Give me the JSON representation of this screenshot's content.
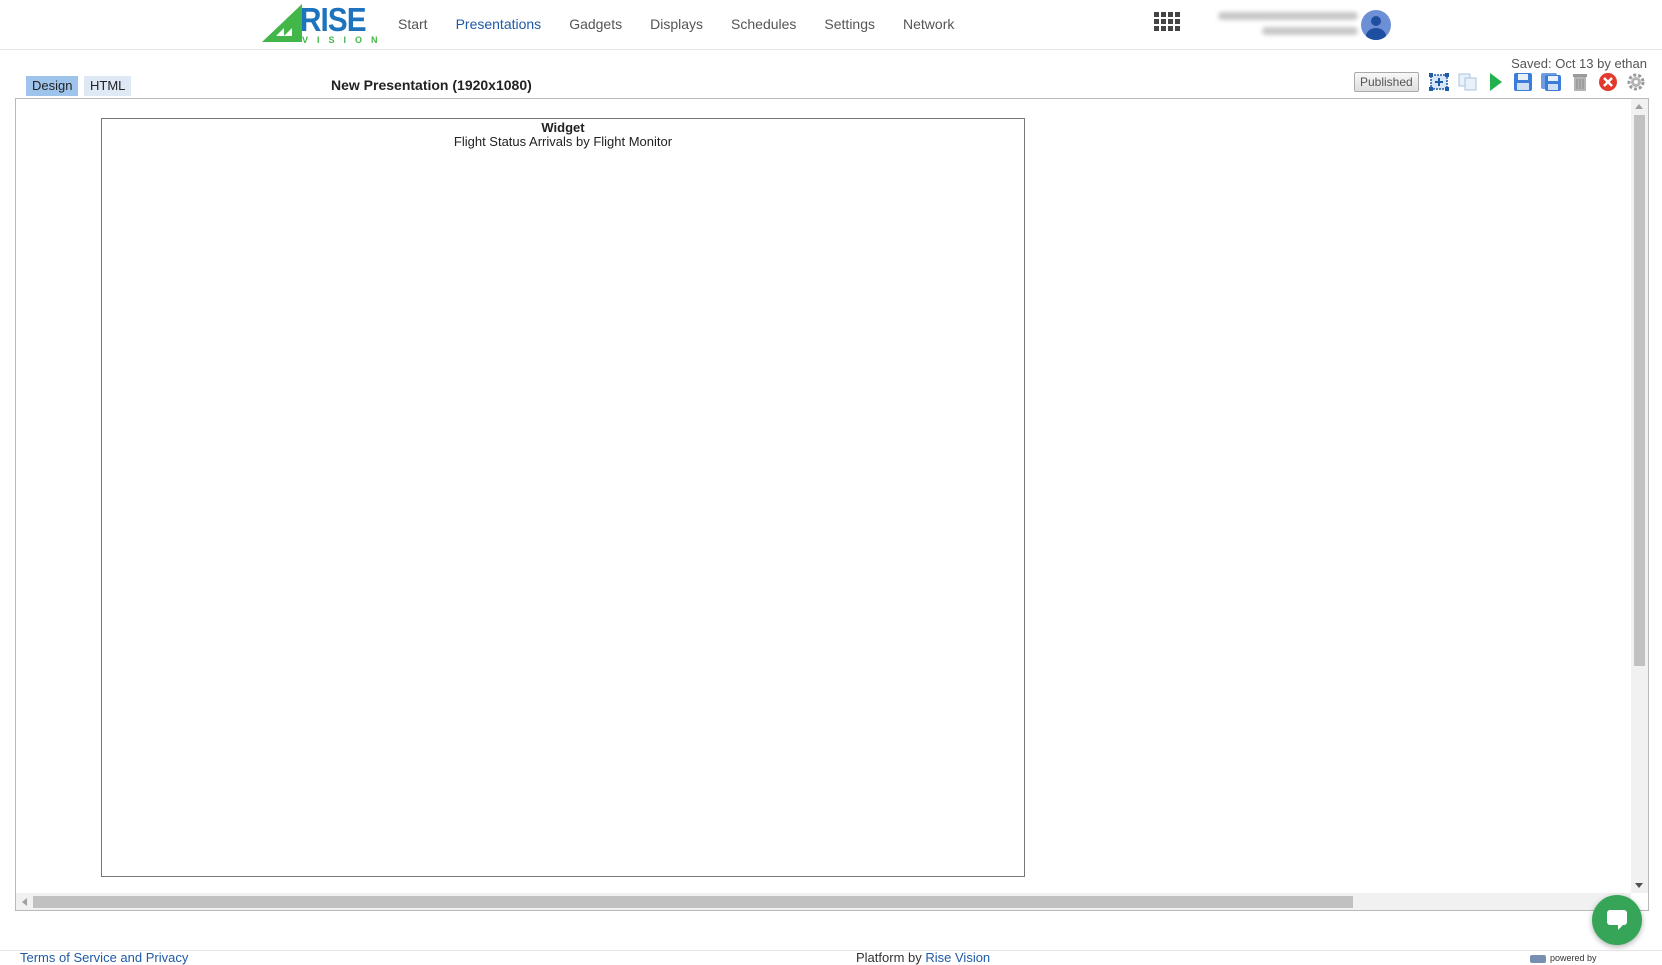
{
  "brand": {
    "logo_word": "RISE",
    "logo_sub": "VISION",
    "colors": {
      "blue": "#1e73be",
      "green": "#43b649"
    }
  },
  "nav": {
    "items": [
      "Start",
      "Presentations",
      "Gadgets",
      "Displays",
      "Schedules",
      "Settings",
      "Network"
    ],
    "active": "Presentations"
  },
  "header": {
    "apps_icon": "grid-apps-icon",
    "avatar_icon": "user-avatar-icon"
  },
  "editor": {
    "saved_status": "Saved: Oct 13 by ethan",
    "tabs": [
      "Design",
      "HTML"
    ],
    "active_tab": "Design",
    "title": "New Presentation (1920x1080)",
    "publish_status": "Published",
    "tools": [
      "placeholder-add-icon",
      "copy-icon",
      "preview-play-icon",
      "save-icon",
      "save-as-icon",
      "delete-trash-icon",
      "close-icon",
      "settings-gear-icon"
    ]
  },
  "placeholder": {
    "title": "Widget",
    "subtitle": "Flight Status Arrivals by Flight Monitor"
  },
  "footer": {
    "terms": "Terms of Service and Privacy",
    "platform_prefix": "Platform by",
    "platform_link": "Rise Vision",
    "powered": "powered by"
  }
}
